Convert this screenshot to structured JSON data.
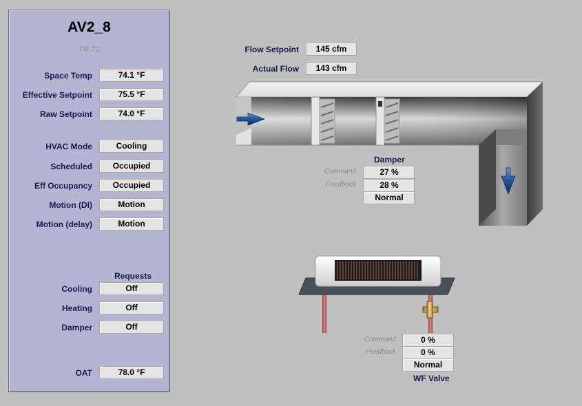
{
  "panel": {
    "title": "AV2_8",
    "subtitle": "TR-71",
    "rows": [
      {
        "label": "Space Temp",
        "value": "74.1 °F"
      },
      {
        "label": "Effective Setpoint",
        "value": "75.5 °F"
      },
      {
        "label": "Raw Setpoint",
        "value": "74.0 °F"
      },
      {
        "label": "HVAC Mode",
        "value": "Cooling"
      },
      {
        "label": "Scheduled",
        "value": "Occupied"
      },
      {
        "label": "Eff Occupancy",
        "value": "Occupied"
      },
      {
        "label": "Motion (DI)",
        "value": "Motion"
      },
      {
        "label": "Motion (delay)",
        "value": "Motion"
      }
    ],
    "requests": {
      "header": "Requests",
      "rows": [
        {
          "label": "Cooling",
          "value": "Off"
        },
        {
          "label": "Heating",
          "value": "Off"
        },
        {
          "label": "Damper",
          "value": "Off"
        }
      ]
    },
    "oat": {
      "label": "OAT",
      "value": "78.0 °F"
    }
  },
  "flow": {
    "setpoint_label": "Flow Setpoint",
    "setpoint_value": "145 cfm",
    "actual_label": "Actual Flow",
    "actual_value": "143 cfm"
  },
  "damper": {
    "header": "Damper",
    "command_label": "Command",
    "command_value": "27 %",
    "feedback_label": "Feedback",
    "feedback_value": "28 %",
    "status": "Normal"
  },
  "valve": {
    "header": "WF Valve",
    "command_label": "Command",
    "command_value": "0 %",
    "feedback_label": "Feedback",
    "feedback_value": "0 %",
    "status": "Normal"
  },
  "icons": {
    "supply_air_arrow": "airflow-arrow-icon",
    "discharge_air_arrow": "airflow-down-arrow-icon"
  }
}
